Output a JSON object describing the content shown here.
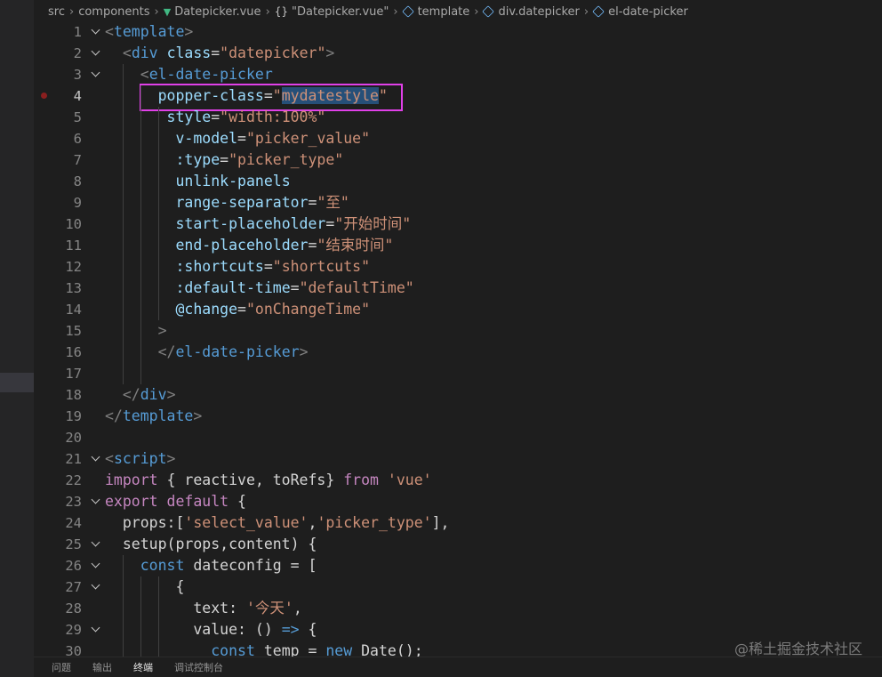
{
  "breadcrumb": {
    "items": [
      "src",
      "components",
      "Datepicker.vue",
      "\"Datepicker.vue\"",
      "template",
      "div.datepicker",
      "el-date-picker"
    ],
    "icons": [
      "",
      "",
      "vue-logo",
      "braces",
      "cube",
      "cube",
      "cube"
    ]
  },
  "editor": {
    "active_line": 4,
    "breakpoint_line": 4,
    "colors": {
      "tag": "#569cd6",
      "attr": "#9cdcfe",
      "string": "#ce9178",
      "keyword": "#c586c0",
      "selection": "#264f78",
      "highlight_box": "#e040e8"
    },
    "lines": [
      {
        "n": "1",
        "fold": true,
        "indent": 0,
        "tokens": [
          [
            "<",
            "punc"
          ],
          [
            "template",
            "tag"
          ],
          [
            ">",
            "punc"
          ]
        ]
      },
      {
        "n": "2",
        "fold": true,
        "indent": 2,
        "tokens": [
          [
            "<",
            "punc"
          ],
          [
            "div",
            "tag"
          ],
          [
            " ",
            "def"
          ],
          [
            "class",
            "attr"
          ],
          [
            "=",
            "def"
          ],
          [
            "\"datepicker\"",
            "str"
          ],
          [
            ">",
            "punc"
          ]
        ]
      },
      {
        "n": "3",
        "fold": true,
        "indent": 4,
        "tokens": [
          [
            "<",
            "punc"
          ],
          [
            "el-date-picker",
            "tag"
          ]
        ]
      },
      {
        "n": "4",
        "fold": false,
        "indent": 6,
        "tokens": [
          [
            "popper-class",
            "attr"
          ],
          [
            "=",
            "def"
          ],
          [
            "\"",
            "str"
          ],
          [
            "mydatestyle",
            "str-sel"
          ],
          [
            "\"",
            "str"
          ]
        ]
      },
      {
        "n": "5",
        "fold": false,
        "indent": 7,
        "tokens": [
          [
            "style",
            "attr"
          ],
          [
            "=",
            "def"
          ],
          [
            "\"width:100%\"",
            "str"
          ]
        ]
      },
      {
        "n": "6",
        "fold": false,
        "indent": 8,
        "tokens": [
          [
            "v-model",
            "attr"
          ],
          [
            "=",
            "def"
          ],
          [
            "\"picker_value\"",
            "str"
          ]
        ]
      },
      {
        "n": "7",
        "fold": false,
        "indent": 8,
        "tokens": [
          [
            ":type",
            "attr"
          ],
          [
            "=",
            "def"
          ],
          [
            "\"picker_type\"",
            "str"
          ]
        ]
      },
      {
        "n": "8",
        "fold": false,
        "indent": 8,
        "tokens": [
          [
            "unlink-panels",
            "attr"
          ]
        ]
      },
      {
        "n": "9",
        "fold": false,
        "indent": 8,
        "tokens": [
          [
            "range-separator",
            "attr"
          ],
          [
            "=",
            "def"
          ],
          [
            "\"至\"",
            "str"
          ]
        ]
      },
      {
        "n": "10",
        "fold": false,
        "indent": 8,
        "tokens": [
          [
            "start-placeholder",
            "attr"
          ],
          [
            "=",
            "def"
          ],
          [
            "\"开始时间\"",
            "str"
          ]
        ]
      },
      {
        "n": "11",
        "fold": false,
        "indent": 8,
        "tokens": [
          [
            "end-placeholder",
            "attr"
          ],
          [
            "=",
            "def"
          ],
          [
            "\"结束时间\"",
            "str"
          ]
        ]
      },
      {
        "n": "12",
        "fold": false,
        "indent": 8,
        "tokens": [
          [
            ":shortcuts",
            "attr"
          ],
          [
            "=",
            "def"
          ],
          [
            "\"shortcuts\"",
            "str"
          ]
        ]
      },
      {
        "n": "13",
        "fold": false,
        "indent": 8,
        "tokens": [
          [
            ":default-time",
            "attr"
          ],
          [
            "=",
            "def"
          ],
          [
            "\"defaultTime\"",
            "str"
          ]
        ]
      },
      {
        "n": "14",
        "fold": false,
        "indent": 8,
        "tokens": [
          [
            "@change",
            "attr"
          ],
          [
            "=",
            "def"
          ],
          [
            "\"onChangeTime\"",
            "str"
          ]
        ]
      },
      {
        "n": "15",
        "fold": false,
        "indent": 6,
        "tokens": [
          [
            ">",
            "punc"
          ]
        ]
      },
      {
        "n": "16",
        "fold": false,
        "indent": 6,
        "tokens": [
          [
            "</",
            "punc"
          ],
          [
            "el-date-picker",
            "tag"
          ],
          [
            ">",
            "punc"
          ]
        ]
      },
      {
        "n": "17",
        "fold": false,
        "indent": 0,
        "tokens": []
      },
      {
        "n": "18",
        "fold": false,
        "indent": 2,
        "tokens": [
          [
            "</",
            "punc"
          ],
          [
            "div",
            "tag"
          ],
          [
            ">",
            "punc"
          ]
        ]
      },
      {
        "n": "19",
        "fold": false,
        "indent": 0,
        "tokens": [
          [
            "</",
            "punc"
          ],
          [
            "template",
            "tag"
          ],
          [
            ">",
            "punc"
          ]
        ]
      },
      {
        "n": "20",
        "fold": false,
        "indent": 0,
        "tokens": []
      },
      {
        "n": "21",
        "fold": true,
        "indent": 0,
        "tokens": [
          [
            "<",
            "punc"
          ],
          [
            "script",
            "tag"
          ],
          [
            ">",
            "punc"
          ]
        ]
      },
      {
        "n": "22",
        "fold": false,
        "indent": 0,
        "tokens": [
          [
            "import",
            "kw"
          ],
          [
            " { reactive, toRefs} ",
            "def"
          ],
          [
            "from",
            "kw"
          ],
          [
            " ",
            "def"
          ],
          [
            "'vue'",
            "str"
          ]
        ]
      },
      {
        "n": "23",
        "fold": true,
        "indent": 0,
        "tokens": [
          [
            "export",
            "kw"
          ],
          [
            " ",
            "def"
          ],
          [
            "default",
            "kw"
          ],
          [
            " {",
            "def"
          ]
        ]
      },
      {
        "n": "24",
        "fold": false,
        "indent": 2,
        "tokens": [
          [
            "props:[",
            "def"
          ],
          [
            "'select_value'",
            "str"
          ],
          [
            ",",
            "def"
          ],
          [
            "'picker_type'",
            "str"
          ],
          [
            "],",
            "def"
          ]
        ]
      },
      {
        "n": "25",
        "fold": true,
        "indent": 2,
        "tokens": [
          [
            "setup(props,content) {",
            "def"
          ]
        ]
      },
      {
        "n": "26",
        "fold": true,
        "indent": 4,
        "tokens": [
          [
            "const",
            "kw2"
          ],
          [
            " dateconfig = [",
            "def"
          ]
        ]
      },
      {
        "n": "27",
        "fold": true,
        "indent": 8,
        "tokens": [
          [
            "{",
            "def"
          ]
        ]
      },
      {
        "n": "28",
        "fold": false,
        "indent": 10,
        "tokens": [
          [
            "text: ",
            "def"
          ],
          [
            "'今天'",
            "str"
          ],
          [
            ",",
            "def"
          ]
        ]
      },
      {
        "n": "29",
        "fold": true,
        "indent": 10,
        "tokens": [
          [
            "value: () ",
            "def"
          ],
          [
            "=>",
            "kw2"
          ],
          [
            " {",
            "def"
          ]
        ]
      },
      {
        "n": "30",
        "fold": false,
        "indent": 12,
        "tokens": [
          [
            "const",
            "kw2"
          ],
          [
            " temp = ",
            "def"
          ],
          [
            "new",
            "kw2"
          ],
          [
            " Date();",
            "def"
          ]
        ]
      }
    ]
  },
  "panel": {
    "tabs": [
      "问题",
      "输出",
      "终端",
      "调试控制台"
    ],
    "active_tab": 2
  },
  "watermark": "@稀土掘金技术社区"
}
